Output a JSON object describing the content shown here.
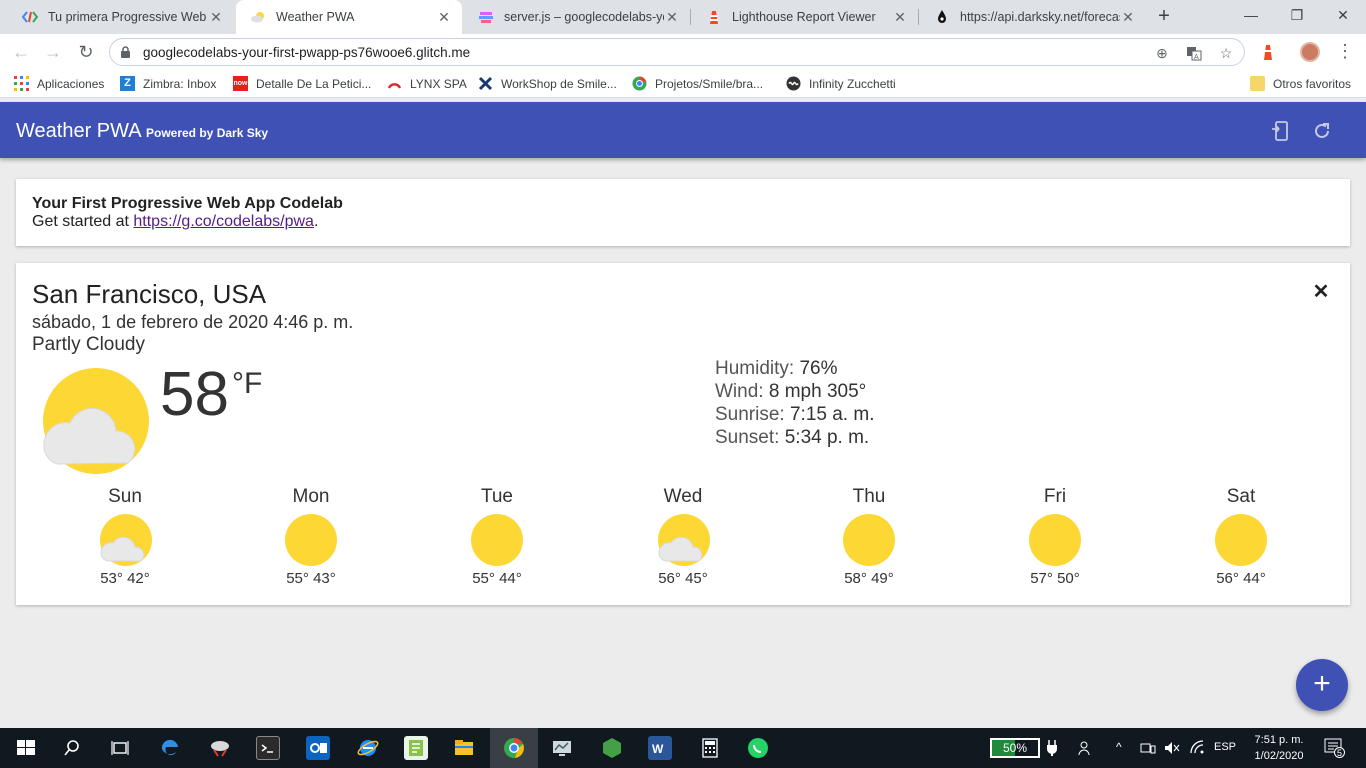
{
  "browser": {
    "tabs": [
      {
        "title": "Tu primera Progressive Web App",
        "active": false,
        "icon": "codelabs-icon"
      },
      {
        "title": "Weather PWA",
        "active": true,
        "icon": "cloud-icon"
      },
      {
        "title": "server.js – googlecodelabs-your-first-pwapp",
        "active": false,
        "icon": "glitch-icon"
      },
      {
        "title": "Lighthouse Report Viewer",
        "active": false,
        "icon": "lighthouse-icon"
      },
      {
        "title": "https://api.darksky.net/forecast",
        "active": false,
        "icon": "darksky-icon"
      }
    ],
    "new_tab": "+",
    "window_controls": {
      "minimize": "—",
      "maximize": "❐",
      "close": "✕"
    },
    "url": "googlecodelabs-your-first-pwapp-ps76wooe6.glitch.me",
    "bookmarks": [
      {
        "label": "Aplicaciones",
        "icon": "apps-grid-icon"
      },
      {
        "label": "Zimbra: Inbox",
        "icon": "zimbra-icon"
      },
      {
        "label": "Detalle De La Petici...",
        "icon": "now-icon"
      },
      {
        "label": "LYNX SPA",
        "icon": "lynx-icon"
      },
      {
        "label": "WorkShop de Smile...",
        "icon": "x-icon"
      },
      {
        "label": "Projetos/Smile/bra...",
        "icon": "chrome-icon"
      },
      {
        "label": "Infinity Zucchetti",
        "icon": "infinity-icon"
      }
    ],
    "other_bookmarks": "Otros favoritos"
  },
  "app": {
    "title": "Weather PWA",
    "subtitle": "Powered by Dark Sky",
    "accent": "#3f51b5"
  },
  "intro": {
    "title": "Your First Progressive Web App Codelab",
    "text_prefix": "Get started at ",
    "link": "https://g.co/codelabs/pwa",
    "text_suffix": "."
  },
  "weather": {
    "city": "San Francisco, USA",
    "date": "sábado, 1 de febrero de 2020 4:46 p. m.",
    "description": "Partly Cloudy",
    "icon": "partly-cloudy-icon",
    "temperature": "58",
    "unit": "°F",
    "details": {
      "humidity_label": "Humidity:",
      "humidity_value": "76%",
      "wind_label": "Wind:",
      "wind_value": "8 mph 305°",
      "sunrise_label": "Sunrise:",
      "sunrise_value": "7:15 a. m.",
      "sunset_label": "Sunset:",
      "sunset_value": "5:34 p. m."
    },
    "forecast": [
      {
        "day": "Sun",
        "icon": "partly-cloudy-icon",
        "temps": "53° 42°"
      },
      {
        "day": "Mon",
        "icon": "sun-icon",
        "temps": "55° 43°"
      },
      {
        "day": "Tue",
        "icon": "sun-icon",
        "temps": "55° 44°"
      },
      {
        "day": "Wed",
        "icon": "partly-cloudy-icon",
        "temps": "56° 45°"
      },
      {
        "day": "Thu",
        "icon": "sun-icon",
        "temps": "58° 49°"
      },
      {
        "day": "Fri",
        "icon": "sun-icon",
        "temps": "57° 50°"
      },
      {
        "day": "Sat",
        "icon": "sun-icon",
        "temps": "56° 44°"
      }
    ]
  },
  "fab": "+",
  "taskbar": {
    "battery": "50%",
    "battery_level": 0.5,
    "language": "ESP",
    "time": "7:51 p. m.",
    "date": "1/02/2020",
    "notifications": "5"
  }
}
